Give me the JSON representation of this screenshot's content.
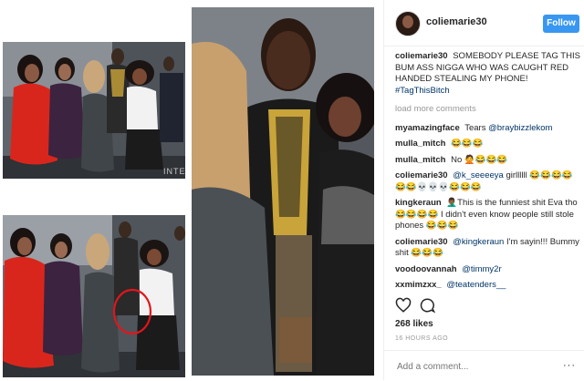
{
  "post": {
    "username": "coliemarie30",
    "follow_label": "Follow",
    "caption_user": "coliemarie30",
    "caption_text": "SOMEBODY PLEASE TAG THIS BUM ASS NIGGA WHO WAS CAUGHT RED HANDED STEALING MY PHONE!",
    "caption_hashtag": "#TagThisBitch",
    "load_more": "load more comments",
    "likes": "268 likes",
    "timestamp": "16 HOURS AGO",
    "add_comment_placeholder": "Add a comment...",
    "more_icon_glyph": "···"
  },
  "comments": [
    {
      "user": "myamazingface",
      "text": "Tears",
      "mention": "@braybizzlekom",
      "after": ""
    },
    {
      "user": "mulla_mitch",
      "text": "😂😂😂",
      "mention": "",
      "after": ""
    },
    {
      "user": "mulla_mitch",
      "text": "No 🙅😂😂😂",
      "mention": "",
      "after": ""
    },
    {
      "user": "coliemarie30",
      "text": "",
      "mention": "@k_seeeeya",
      "after": "girllllll 😂😂😂😂😂😂💀💀💀😂😂😂"
    },
    {
      "user": "kingkeraun",
      "text": "🤦🏾‍♂️This is the funniest shit Eva tho 😂😂😂😂 I didn't even know people still stole phones 😂😂😂",
      "mention": "",
      "after": ""
    },
    {
      "user": "coliemarie30",
      "text": "",
      "mention": "@kingkeraun",
      "after": "I'm sayin!!! Bummy shit 😂😂😂"
    },
    {
      "user": "voodoovannah",
      "text": "",
      "mention": "@timmy2r",
      "after": ""
    },
    {
      "user": "xxmimzxx_",
      "text": "",
      "mention": "@teatenders__",
      "after": ""
    }
  ],
  "photos": {
    "watermark": "INTE"
  },
  "colors": {
    "follow": "#3897f0",
    "mention": "#003569",
    "red_dress": "#d9261c",
    "circle": "#e0161b"
  }
}
